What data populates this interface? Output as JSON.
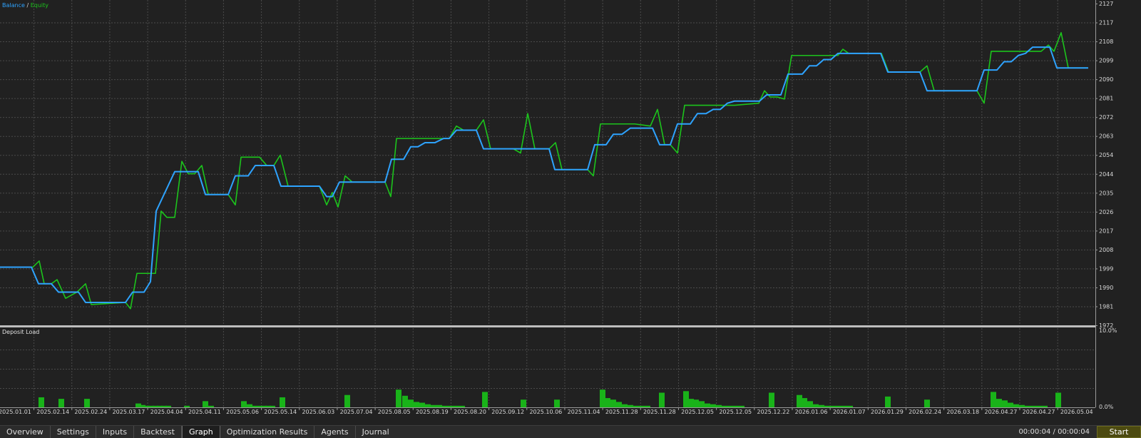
{
  "legend": {
    "balance": "Balance",
    "separator": " / ",
    "equity": "Equity"
  },
  "subpanel": {
    "title": "Deposit Load",
    "top_label": "10.0%",
    "bottom_label": "0.0%"
  },
  "colors": {
    "balance": "#2ea3ff",
    "equity": "#1cc41c",
    "bars": "#19b319",
    "background": "#212121",
    "grid": "#4a4a4a"
  },
  "tabs": [
    {
      "label": "Overview",
      "active": false
    },
    {
      "label": "Settings",
      "active": false
    },
    {
      "label": "Inputs",
      "active": false
    },
    {
      "label": "Backtest",
      "active": false
    },
    {
      "label": "Graph",
      "active": true
    },
    {
      "label": "Optimization Results",
      "active": false
    },
    {
      "label": "Agents",
      "active": false
    },
    {
      "label": "Journal",
      "active": false
    }
  ],
  "status": {
    "timer": "00:00:04 / 00:00:04",
    "start_label": "Start"
  },
  "chart_data": {
    "type": "line",
    "ylim": [
      1977,
      2127
    ],
    "y_ticks": [
      2127,
      2117,
      2108,
      2099,
      2090,
      2081,
      2072,
      2063,
      2054,
      2044,
      2035,
      2026,
      2017,
      2008,
      1999,
      1990,
      1981,
      1972
    ],
    "x_ticks": [
      "2025.01.01",
      "2025.02.14",
      "2025.02.24",
      "2025.03.17",
      "2025.04.04",
      "2025.04.11",
      "2025.05.06",
      "2025.05.14",
      "2025.06.03",
      "2025.07.04",
      "2025.08.05",
      "2025.08.19",
      "2025.08.20",
      "2025.09.12",
      "2025.10.06",
      "2025.11.04",
      "2025.11.28",
      "2025.11.28",
      "2025.12.05",
      "2025.12.05",
      "2025.12.22",
      "2026.01.06",
      "2026.01.07",
      "2026.01.29",
      "2026.02.24",
      "2026.03.18",
      "2026.04.27",
      "2026.04.27",
      "2026.05.04"
    ],
    "grid": true,
    "legend_position": "top-left",
    "series": [
      {
        "name": "Balance",
        "points": [
          [
            0,
            2000
          ],
          [
            44,
            2000
          ],
          [
            54,
            1992
          ],
          [
            72,
            1992
          ],
          [
            82,
            1988
          ],
          [
            110,
            1988
          ],
          [
            120,
            1983
          ],
          [
            176,
            1983
          ],
          [
            186,
            1988
          ],
          [
            202,
            1988
          ],
          [
            211,
            1993
          ],
          [
            219,
            2027
          ],
          [
            245,
            2046
          ],
          [
            278,
            2046
          ],
          [
            288,
            2035
          ],
          [
            320,
            2035
          ],
          [
            330,
            2044
          ],
          [
            348,
            2044
          ],
          [
            358,
            2049
          ],
          [
            384,
            2049
          ],
          [
            394,
            2039
          ],
          [
            448,
            2039
          ],
          [
            458,
            2034
          ],
          [
            466,
            2034
          ],
          [
            476,
            2041
          ],
          [
            540,
            2041
          ],
          [
            549,
            2052
          ],
          [
            566,
            2052
          ],
          [
            576,
            2058
          ],
          [
            586,
            2058
          ],
          [
            596,
            2060
          ],
          [
            610,
            2060
          ],
          [
            622,
            2062
          ],
          [
            630,
            2062
          ],
          [
            640,
            2066
          ],
          [
            668,
            2066
          ],
          [
            678,
            2057
          ],
          [
            770,
            2057
          ],
          [
            778,
            2047
          ],
          [
            824,
            2047
          ],
          [
            834,
            2059
          ],
          [
            850,
            2059
          ],
          [
            860,
            2064
          ],
          [
            872,
            2064
          ],
          [
            884,
            2067
          ],
          [
            915,
            2067
          ],
          [
            925,
            2059
          ],
          [
            940,
            2059
          ],
          [
            950,
            2069
          ],
          [
            968,
            2069
          ],
          [
            978,
            2074
          ],
          [
            990,
            2074
          ],
          [
            1000,
            2076
          ],
          [
            1010,
            2076
          ],
          [
            1020,
            2079
          ],
          [
            1030,
            2080
          ],
          [
            1065,
            2080
          ],
          [
            1075,
            2083
          ],
          [
            1095,
            2083
          ],
          [
            1105,
            2093
          ],
          [
            1125,
            2093
          ],
          [
            1135,
            2097
          ],
          [
            1145,
            2097
          ],
          [
            1155,
            2100
          ],
          [
            1165,
            2100
          ],
          [
            1175,
            2103
          ],
          [
            1235,
            2103
          ],
          [
            1245,
            2094
          ],
          [
            1290,
            2094
          ],
          [
            1300,
            2085
          ],
          [
            1370,
            2085
          ],
          [
            1380,
            2095
          ],
          [
            1398,
            2095
          ],
          [
            1408,
            2099
          ],
          [
            1418,
            2099
          ],
          [
            1428,
            2102
          ],
          [
            1438,
            2103
          ],
          [
            1448,
            2106
          ],
          [
            1462,
            2106
          ],
          [
            1472,
            2106
          ],
          [
            1482,
            2096
          ],
          [
            1526,
            2096
          ]
        ]
      },
      {
        "name": "Equity",
        "points": [
          [
            0,
            2000
          ],
          [
            46,
            2000
          ],
          [
            55,
            2003
          ],
          [
            62,
            1992
          ],
          [
            72,
            1992
          ],
          [
            80,
            1994
          ],
          [
            92,
            1985
          ],
          [
            108,
            1988
          ],
          [
            120,
            1992
          ],
          [
            128,
            1982
          ],
          [
            176,
            1983
          ],
          [
            183,
            1980
          ],
          [
            192,
            1997
          ],
          [
            218,
            1997
          ],
          [
            226,
            2027
          ],
          [
            234,
            2024
          ],
          [
            245,
            2024
          ],
          [
            255,
            2051
          ],
          [
            264,
            2045
          ],
          [
            273,
            2045
          ],
          [
            283,
            2049
          ],
          [
            292,
            2035
          ],
          [
            320,
            2035
          ],
          [
            330,
            2030
          ],
          [
            338,
            2053
          ],
          [
            364,
            2053
          ],
          [
            374,
            2049
          ],
          [
            384,
            2049
          ],
          [
            393,
            2054
          ],
          [
            404,
            2039
          ],
          [
            448,
            2039
          ],
          [
            458,
            2030
          ],
          [
            466,
            2036
          ],
          [
            474,
            2029
          ],
          [
            484,
            2044
          ],
          [
            494,
            2041
          ],
          [
            540,
            2041
          ],
          [
            548,
            2034
          ],
          [
            556,
            2062
          ],
          [
            610,
            2062
          ],
          [
            622,
            2062
          ],
          [
            630,
            2062
          ],
          [
            640,
            2068
          ],
          [
            650,
            2066
          ],
          [
            668,
            2066
          ],
          [
            678,
            2071
          ],
          [
            688,
            2057
          ],
          [
            720,
            2057
          ],
          [
            730,
            2055
          ],
          [
            740,
            2074
          ],
          [
            750,
            2057
          ],
          [
            770,
            2057
          ],
          [
            779,
            2060
          ],
          [
            788,
            2047
          ],
          [
            824,
            2047
          ],
          [
            832,
            2044
          ],
          [
            842,
            2069
          ],
          [
            890,
            2069
          ],
          [
            912,
            2068
          ],
          [
            922,
            2076
          ],
          [
            932,
            2059
          ],
          [
            940,
            2059
          ],
          [
            950,
            2055
          ],
          [
            960,
            2078
          ],
          [
            1030,
            2078
          ],
          [
            1064,
            2079
          ],
          [
            1072,
            2085
          ],
          [
            1080,
            2082
          ],
          [
            1090,
            2082
          ],
          [
            1100,
            2081
          ],
          [
            1110,
            2102
          ],
          [
            1165,
            2102
          ],
          [
            1175,
            2102
          ],
          [
            1182,
            2105
          ],
          [
            1190,
            2103
          ],
          [
            1236,
            2103
          ],
          [
            1246,
            2094
          ],
          [
            1290,
            2094
          ],
          [
            1300,
            2097
          ],
          [
            1310,
            2085
          ],
          [
            1370,
            2085
          ],
          [
            1380,
            2079
          ],
          [
            1390,
            2104
          ],
          [
            1448,
            2104
          ],
          [
            1460,
            2104
          ],
          [
            1470,
            2107
          ],
          [
            1478,
            2104
          ],
          [
            1488,
            2113
          ],
          [
            1498,
            2096
          ],
          [
            1526,
            2096
          ]
        ]
      }
    ],
    "deposit_load": {
      "ylim": [
        0,
        10
      ],
      "unit": "%",
      "bars": [
        [
          58,
          1.3
        ],
        [
          86,
          1.1
        ],
        [
          122,
          1.1
        ],
        [
          194,
          0.5
        ],
        [
          200,
          0.3
        ],
        [
          206,
          0.2
        ],
        [
          212,
          0.2
        ],
        [
          218,
          0.2
        ],
        [
          224,
          0.2
        ],
        [
          230,
          0.2
        ],
        [
          236,
          0.2
        ],
        [
          262,
          0.2
        ],
        [
          288,
          0.8
        ],
        [
          296,
          0.2
        ],
        [
          342,
          0.8
        ],
        [
          350,
          0.4
        ],
        [
          356,
          0.2
        ],
        [
          364,
          0.2
        ],
        [
          370,
          0.2
        ],
        [
          376,
          0.2
        ],
        [
          382,
          0.2
        ],
        [
          396,
          1.3
        ],
        [
          487,
          1.6
        ],
        [
          559,
          2.3
        ],
        [
          568,
          1.5
        ],
        [
          576,
          1.0
        ],
        [
          584,
          0.7
        ],
        [
          592,
          0.6
        ],
        [
          600,
          0.4
        ],
        [
          608,
          0.3
        ],
        [
          616,
          0.3
        ],
        [
          624,
          0.2
        ],
        [
          632,
          0.2
        ],
        [
          640,
          0.2
        ],
        [
          648,
          0.2
        ],
        [
          680,
          2.0
        ],
        [
          734,
          1.0
        ],
        [
          781,
          1.0
        ],
        [
          845,
          2.3
        ],
        [
          852,
          1.2
        ],
        [
          860,
          1.0
        ],
        [
          868,
          0.7
        ],
        [
          876,
          0.4
        ],
        [
          884,
          0.3
        ],
        [
          892,
          0.2
        ],
        [
          900,
          0.2
        ],
        [
          908,
          0.2
        ],
        [
          928,
          1.9
        ],
        [
          962,
          2.1
        ],
        [
          969,
          1.1
        ],
        [
          976,
          1.0
        ],
        [
          984,
          0.8
        ],
        [
          992,
          0.5
        ],
        [
          1000,
          0.4
        ],
        [
          1008,
          0.3
        ],
        [
          1016,
          0.2
        ],
        [
          1024,
          0.2
        ],
        [
          1032,
          0.2
        ],
        [
          1040,
          0.2
        ],
        [
          1082,
          1.9
        ],
        [
          1121,
          1.6
        ],
        [
          1128,
          1.2
        ],
        [
          1136,
          0.8
        ],
        [
          1144,
          0.4
        ],
        [
          1152,
          0.3
        ],
        [
          1160,
          0.2
        ],
        [
          1168,
          0.2
        ],
        [
          1176,
          0.2
        ],
        [
          1184,
          0.2
        ],
        [
          1192,
          0.2
        ],
        [
          1245,
          1.4
        ],
        [
          1300,
          1.0
        ],
        [
          1393,
          2.0
        ],
        [
          1401,
          1.1
        ],
        [
          1409,
          0.9
        ],
        [
          1417,
          0.6
        ],
        [
          1425,
          0.4
        ],
        [
          1433,
          0.3
        ],
        [
          1441,
          0.2
        ],
        [
          1449,
          0.2
        ],
        [
          1457,
          0.2
        ],
        [
          1465,
          0.2
        ],
        [
          1484,
          1.9
        ]
      ]
    }
  }
}
